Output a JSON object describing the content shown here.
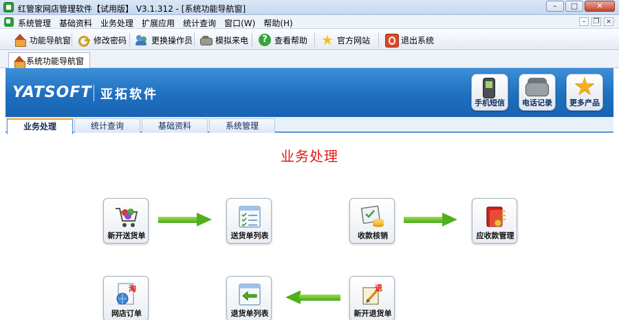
{
  "window": {
    "title": "红管家网店管理软件【试用版】 V3.1.312 - [系统功能导航窗]",
    "buttons": {
      "minimize": "–",
      "maximize": "□",
      "close": "✕"
    }
  },
  "menubar": {
    "items": [
      "系统管理",
      "基础资料",
      "业务处理",
      "扩展应用",
      "统计查询",
      "窗口(W)",
      "帮助(H)"
    ],
    "mdi_buttons": {
      "minimize": "–",
      "restore": "❐",
      "close": "×"
    }
  },
  "toolbar": {
    "items": [
      {
        "label": "功能导航窗",
        "icon": "home-icon"
      },
      {
        "label": "修改密码",
        "icon": "key-icon"
      },
      {
        "label": "更换操作员",
        "icon": "users-icon"
      },
      {
        "label": "模拟来电",
        "icon": "phone-icon"
      },
      {
        "label": "查看帮助",
        "icon": "help-icon"
      },
      {
        "label": "官方网站",
        "icon": "star-icon"
      },
      {
        "label": "退出系统",
        "icon": "exit-icon"
      }
    ]
  },
  "document_tab": {
    "label": "系统功能导航窗",
    "icon": "home-icon"
  },
  "banner": {
    "logo": "YATSOFT",
    "brand_cn": "亚拓软件",
    "quick_buttons": [
      {
        "label": "手机短信",
        "icon": "mobile-phone-icon"
      },
      {
        "label": "电话记录",
        "icon": "telephone-icon"
      },
      {
        "label": "更多产品",
        "icon": "star-icon"
      }
    ]
  },
  "content_tabs": {
    "items": [
      "业务处理",
      "统计查询",
      "基础资料",
      "系统管理"
    ],
    "active": "业务处理"
  },
  "panel": {
    "title": "业务处理",
    "modules": [
      {
        "label": "新开送货单",
        "icon": "shopping-cart-icon"
      },
      {
        "label": "送货单列表",
        "icon": "checklist-icon"
      },
      {
        "label": "收款核销",
        "icon": "coins-icon"
      },
      {
        "label": "应收款管理",
        "icon": "ledger-icon"
      },
      {
        "label": "网店订单",
        "icon": "online-order-icon"
      },
      {
        "label": "退货单列表",
        "icon": "return-list-icon"
      },
      {
        "label": "新开退货单",
        "icon": "new-return-icon"
      }
    ]
  },
  "colors": {
    "banner_blue": "#1f6fc0",
    "section_title_red": "#e01818",
    "arrow_green": "#4fb01c",
    "tab_accent": "#f0a020"
  }
}
